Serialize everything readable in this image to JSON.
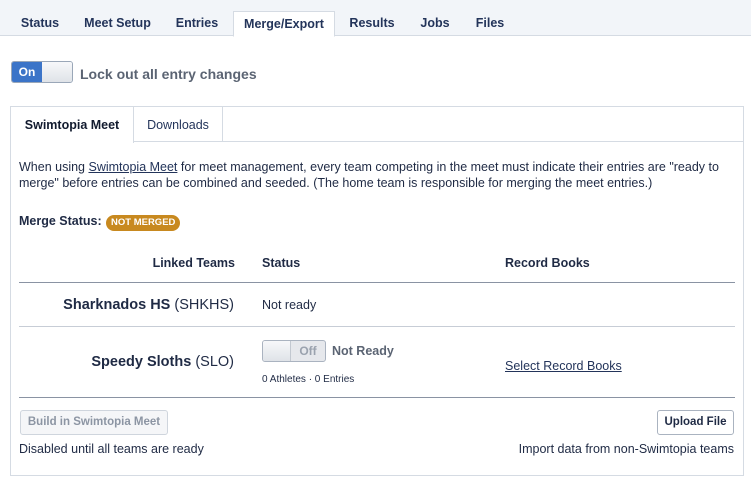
{
  "top_tabs": [
    {
      "label": "Status"
    },
    {
      "label": "Meet Setup"
    },
    {
      "label": "Entries"
    },
    {
      "label": "Merge/Export",
      "active": true
    },
    {
      "label": "Results"
    },
    {
      "label": "Jobs"
    },
    {
      "label": "Files"
    }
  ],
  "lockout": {
    "toggle_label": "On",
    "label": "Lock out all entry changes"
  },
  "sub_tabs": [
    {
      "label": "Swimtopia Meet",
      "active": true
    },
    {
      "label": "Downloads"
    }
  ],
  "intro": {
    "prefix": "When using ",
    "link": "Swimtopia Meet",
    "suffix": " for meet management, every team competing in the meet must indicate their entries are \"ready to merge\" before entries can be combined and seeded. (The home team is responsible for merging the meet entries.)"
  },
  "merge_status": {
    "label": "Merge Status:",
    "badge": "NOT MERGED",
    "badge_color": "#c8891f"
  },
  "table": {
    "headers": [
      "Linked Teams",
      "Status",
      "Record Books"
    ],
    "rows": [
      {
        "team": "Sharknados HS",
        "code": "(SHKHS)",
        "status": "Not ready"
      },
      {
        "team": "Speedy Sloths",
        "code": "(SLO)",
        "toggle": "Off",
        "status": "Not Ready",
        "counts": "0 Athletes · 0 Entries",
        "record_link": "Select Record Books"
      }
    ]
  },
  "footer": {
    "build_button": "Build in Swimtopia Meet",
    "build_note": "Disabled until all teams are ready",
    "upload_button": "Upload File",
    "upload_note": "Import data from non-Swimtopia teams"
  },
  "colors": {
    "accent": "#3b74c8",
    "text": "#1f2a44",
    "tab_bar": "#f2f5f9"
  }
}
